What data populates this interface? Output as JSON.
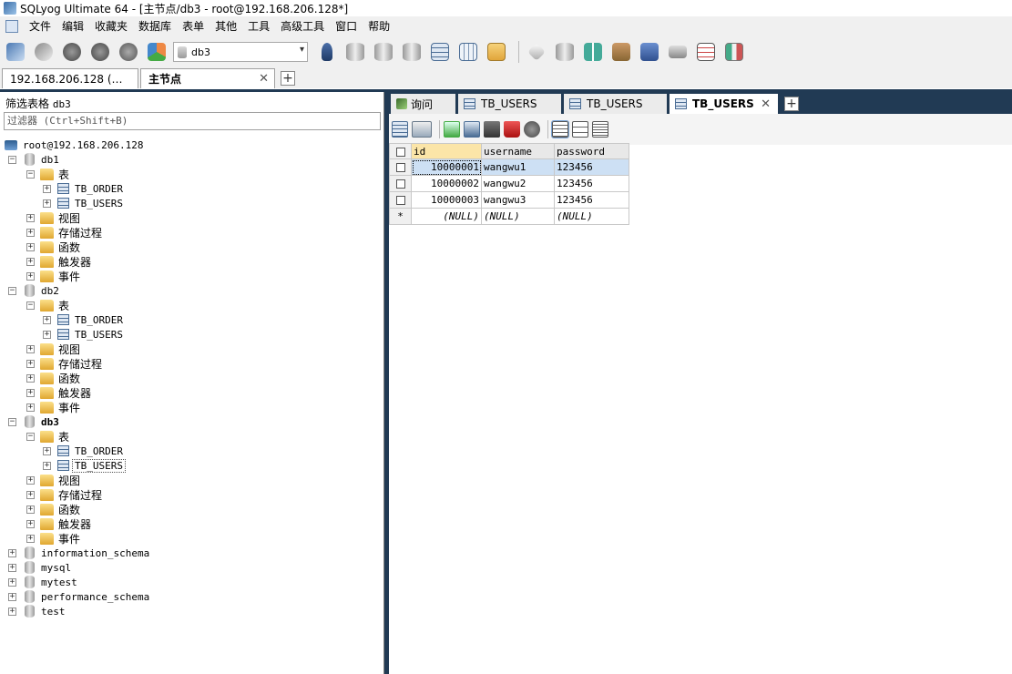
{
  "window": {
    "title": "SQLyog Ultimate 64 - [主节点/db3 - root@192.168.206.128*]"
  },
  "menu": [
    "文件",
    "编辑",
    "收藏夹",
    "数据库",
    "表单",
    "其他",
    "工具",
    "高级工具",
    "窗口",
    "帮助"
  ],
  "toolbar": {
    "db_select": "db3"
  },
  "connection_tabs": [
    {
      "label": "192.168.206.128 (…",
      "active": false
    },
    {
      "label": "主节点",
      "active": true
    }
  ],
  "object_browser": {
    "filter_label": "筛选表格",
    "filter_db": "db3",
    "filter_placeholder": "过滤器 (Ctrl+Shift+B)",
    "root": "root@192.168.206.128",
    "folders": {
      "tables": "表",
      "views": "视图",
      "procedures": "存储过程",
      "functions": "函数",
      "triggers": "触发器",
      "events": "事件"
    },
    "databases": [
      {
        "name": "db1",
        "tables": [
          "TB_ORDER",
          "TB_USERS"
        ]
      },
      {
        "name": "db2",
        "tables": [
          "TB_ORDER",
          "TB_USERS"
        ]
      },
      {
        "name": "db3",
        "tables": [
          "TB_ORDER",
          "TB_USERS"
        ]
      }
    ],
    "other_databases": [
      "information_schema",
      "mysql",
      "mytest",
      "performance_schema",
      "test"
    ]
  },
  "query_tabs": [
    {
      "label": "询问",
      "active": false
    },
    {
      "label": "TB_USERS",
      "active": false
    },
    {
      "label": "TB_USERS",
      "active": false
    },
    {
      "label": "TB_USERS",
      "active": true
    }
  ],
  "result_grid": {
    "columns": [
      "id",
      "username",
      "password"
    ],
    "rows": [
      [
        "10000001",
        "wangwu1",
        "123456"
      ],
      [
        "10000002",
        "wangwu2",
        "123456"
      ],
      [
        "10000003",
        "wangwu3",
        "123456"
      ]
    ],
    "new_row": [
      "(NULL)",
      "(NULL)",
      "(NULL)"
    ],
    "new_row_marker": "*"
  },
  "colors": {
    "dark_bar": "#213a54",
    "selected_row": "#cde0f4",
    "id_header": "#fbe5a8"
  }
}
